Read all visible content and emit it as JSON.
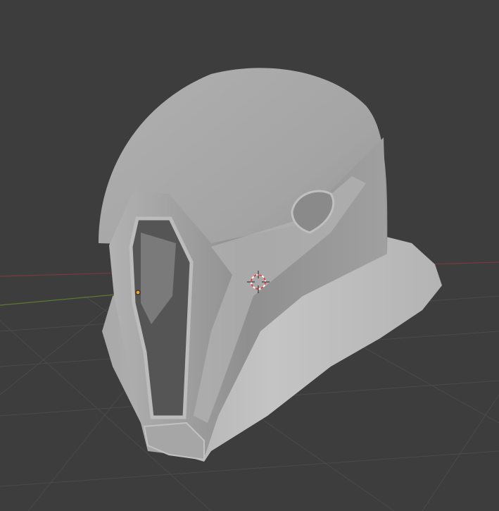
{
  "viewport": {
    "background": "#3d3d3d",
    "grid_color": "#4a4a4a",
    "x_axis_color": "#7a3a3e",
    "y_axis_color": "#5a7a2e",
    "origin_color": "#f0a030",
    "cursor_colors": [
      "#e04040",
      "#ffffff"
    ]
  },
  "object": {
    "shell_color": "#a8a8a8",
    "brim_color": "#bdbdbd",
    "face_color": "#9a9a9a",
    "opening_color": "#555555"
  }
}
